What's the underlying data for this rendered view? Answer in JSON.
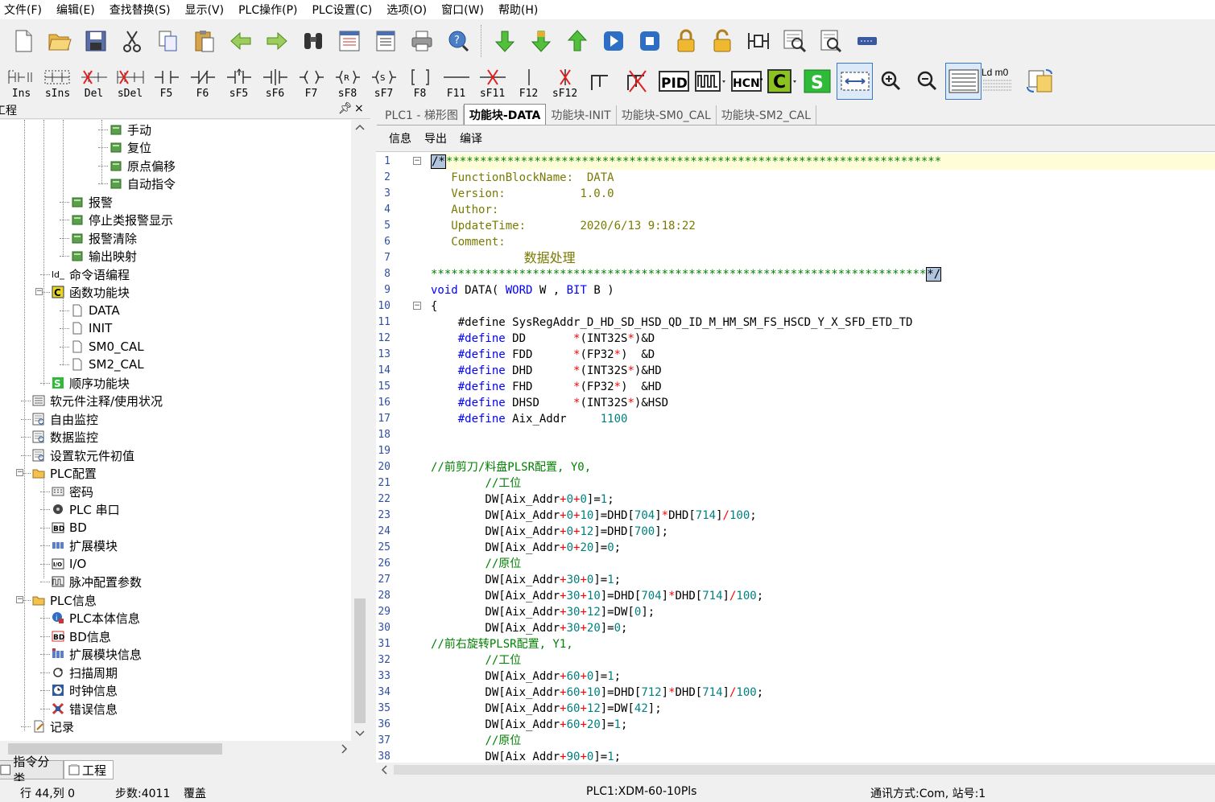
{
  "menu": [
    "文件(F)",
    "编辑(E)",
    "查找替换(S)",
    "显示(V)",
    "PLC操作(P)",
    "PLC设置(C)",
    "选项(O)",
    "窗口(W)",
    "帮助(H)"
  ],
  "ladder_keys": [
    {
      "name": "ins",
      "label": "Ins"
    },
    {
      "name": "sins",
      "label": "sIns"
    },
    {
      "name": "del",
      "label": "Del"
    },
    {
      "name": "sdel",
      "label": "sDel"
    },
    {
      "name": "f5",
      "label": "F5"
    },
    {
      "name": "f6",
      "label": "F6"
    },
    {
      "name": "sf5",
      "label": "sF5"
    },
    {
      "name": "sf6",
      "label": "sF6"
    },
    {
      "name": "f7",
      "label": "F7"
    },
    {
      "name": "sf8",
      "label": "sF8"
    },
    {
      "name": "sf7",
      "label": "sF7"
    },
    {
      "name": "f8",
      "label": "F8"
    },
    {
      "name": "f11",
      "label": "F11"
    },
    {
      "name": "sf11",
      "label": "sF11"
    },
    {
      "name": "f12",
      "label": "F12"
    },
    {
      "name": "sf12",
      "label": "sF12"
    }
  ],
  "ldm0_label": "Ld m0",
  "left_panel": {
    "title": "工程",
    "pin": "ᵖ",
    "close": "×",
    "tabs": [
      "指令分类",
      "工程"
    ],
    "tree": [
      {
        "label": "手动",
        "icon": "green-block"
      },
      {
        "label": "复位",
        "icon": "green-block"
      },
      {
        "label": "原点偏移",
        "icon": "green-block"
      },
      {
        "label": "自动指令",
        "icon": "green-block"
      },
      {
        "label": "报警",
        "icon": "green-block"
      },
      {
        "label": "停止类报警显示",
        "icon": "green-block"
      },
      {
        "label": "报警清除",
        "icon": "green-block"
      },
      {
        "label": "输出映射",
        "icon": "green-block"
      },
      {
        "label": "命令语编程",
        "icon": "ld-icon"
      },
      {
        "label": "函数功能块",
        "icon": "c-icon"
      },
      {
        "label": "DATA",
        "icon": "page-icon"
      },
      {
        "label": "INIT",
        "icon": "page-icon"
      },
      {
        "label": "SM0_CAL",
        "icon": "page-icon"
      },
      {
        "label": "SM2_CAL",
        "icon": "page-icon"
      },
      {
        "label": "顺序功能块",
        "icon": "s-icon"
      },
      {
        "label": "软元件注释/使用状况",
        "icon": "list-icon"
      },
      {
        "label": "自由监控",
        "icon": "monitor-icon"
      },
      {
        "label": "数据监控",
        "icon": "monitor-icon"
      },
      {
        "label": "设置软元件初值",
        "icon": "monitor-icon"
      },
      {
        "label": "PLC配置",
        "icon": "folder-icon"
      },
      {
        "label": "密码",
        "icon": "keypad-icon"
      },
      {
        "label": "PLC 串口",
        "icon": "port-icon"
      },
      {
        "label": "BD",
        "icon": "bd-icon"
      },
      {
        "label": "扩展模块",
        "icon": "module-icon"
      },
      {
        "label": "I/O",
        "icon": "io-icon"
      },
      {
        "label": "脉冲配置参数",
        "icon": "pulse-icon"
      },
      {
        "label": "PLC信息",
        "icon": "folder-icon"
      },
      {
        "label": "PLC本体信息",
        "icon": "info-icon"
      },
      {
        "label": "BD信息",
        "icon": "bd-info-icon"
      },
      {
        "label": "扩展模块信息",
        "icon": "module-info-icon"
      },
      {
        "label": "扫描周期",
        "icon": "cycle-icon"
      },
      {
        "label": "时钟信息",
        "icon": "clock-icon"
      },
      {
        "label": "错误信息",
        "icon": "error-icon"
      },
      {
        "label": "记录",
        "icon": "record-icon"
      }
    ]
  },
  "doc_tabs": [
    "PLC1 - 梯形图",
    "功能块-DATA",
    "功能块-INIT",
    "功能块-SM0_CAL",
    "功能块-SM2_CAL"
  ],
  "sub_toolbar": [
    "信息",
    "导出",
    "编译"
  ],
  "code_lines": [
    "1",
    "2",
    "3",
    "4",
    "5",
    "6",
    "7",
    "8",
    "9",
    "10",
    "11",
    "12",
    "13",
    "14",
    "15",
    "16",
    "17",
    "18",
    "19",
    "20",
    "21",
    "22",
    "23",
    "24",
    "25",
    "26",
    "27",
    "28",
    "29",
    "30",
    "31",
    "32",
    "33",
    "34",
    "35",
    "36",
    "37",
    "38"
  ],
  "code": {
    "l2a": "FunctionBlockName:",
    "l2b": "DATA",
    "l3a": "Version:",
    "l3b": "1.0.0",
    "l4a": "Author:",
    "l5a": "UpdateTime:",
    "l5b": "2020/6/13 9:18:22",
    "l6a": "Comment:",
    "l7": "数据处理",
    "l11": "#define SysRegAddr_D_HD_SD_HSD_QD_ID_M_HM_SM_FS_HSCD_Y_X_SFD_ETD_TD",
    "l20": "//前剪刀/料盘PLSR配置, Y0,",
    "l21": "//工位",
    "l26": "//原位",
    "l31": "//前右旋转PLSR配置, Y1,",
    "l32": "//工位",
    "l37": "//原位"
  },
  "status": {
    "position": "行 44,列 0",
    "steps": "步数:4011",
    "mode": "覆盖",
    "plc": "PLC1:XDM-60-10Pls",
    "comm": "通讯方式:Com, 站号:1"
  }
}
